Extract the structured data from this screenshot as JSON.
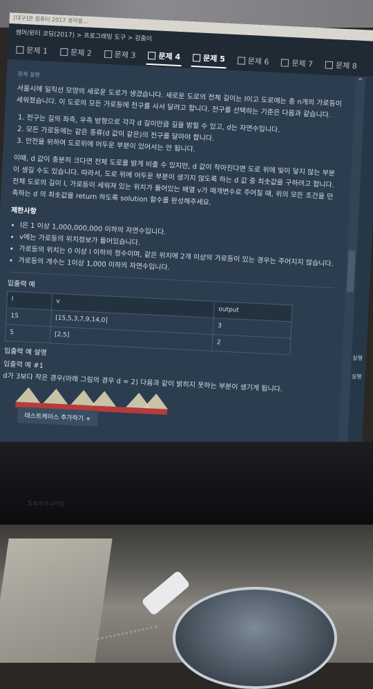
{
  "window": {
    "titlebar": "[대구]큰 컴퓨터 2017 생각을...",
    "breadcrumb": "썸머/윈터 코딩(2017) > 프로그래밍 도구 > 감춤이"
  },
  "tabs": [
    "문제 1",
    "문제 2",
    "문제 3",
    "문제 4",
    "문제 5",
    "문제 6",
    "문제 7",
    "문제 8"
  ],
  "active_tab": "문제 4",
  "problem": {
    "section_label": "문제 설명",
    "intro": "서울시에 일직선 모양의 새로운 도로가 생겼습니다. 새로운 도로의 전체 길이는 l이고 도로에는 총 n개의 가로등이 세워졌습니다. 이 도로의 모든 가로등에 전구를 사서 달려고 합니다. 전구를 선택하는 기준은 다음과 같습니다.",
    "rules": [
      "전구는 길의 좌측, 우측 방향으로 각각 d 길이만큼 길을 밝힐 수 있고, d는 자연수입니다.",
      "모든 가로등에는 같은 종류(d 값이 같은)의 전구를 달아야 합니다.",
      "안전을 위하여 도로위에 어두운 부분이 있어서는 안 됩니다."
    ],
    "body": "이때, d 값이 충분히 크다면 전체 도로를 밝게 비출 수 있지만, d 값이 작아진다면 도로 위에 빛이 닿지 않는 부분이 생길 수도 있습니다. 따라서, 도로 위에 어두운 부분이 생기지 않도록 하는 d 값 중 최솟값을 구하려고 합니다. 전체 도로의 길이 l, 가로등이 세워져 있는 위치가 들어있는 배열 v가 매개변수로 주어질 때, 위의 모든 조건을 만족하는 d 의 최솟값을 return 하도록 solution 함수를 완성해주세요."
  },
  "constraints": {
    "title": "제한사항",
    "items": [
      "l은 1 이상 1,000,000,000 이하의 자연수입니다.",
      "v에는 가로등의 위치정보가 들어있습니다.",
      "가로등의 위치는 0 이상 l 이하의 정수이며, 같은 위치에 2개 이상의 가로등이 있는 경우는 주어지지 않습니다.",
      "가로등의 개수는 1이상 1,000 이하의 자연수입니다."
    ]
  },
  "io": {
    "title": "입출력 예",
    "headers": [
      "l",
      "v",
      "output"
    ],
    "rows": [
      [
        "15",
        "[15,5,3,7,9,14,0]",
        "3"
      ],
      [
        "5",
        "[2,5]",
        "2"
      ]
    ]
  },
  "explanation": {
    "title": "입출력 예 설명",
    "subtitle": "입출력 예 #1",
    "text": "d가 3보다 작은 경우(아래 그림의 경우 d = 2) 다음과 같이 밝히지 못하는 부분이 생기게 됩니다."
  },
  "buttons": {
    "add_testcase": "테스트케이스 추가하기 +"
  },
  "side": {
    "run1": "실행",
    "run2": "실행"
  },
  "monitor_brand": "Samsung"
}
